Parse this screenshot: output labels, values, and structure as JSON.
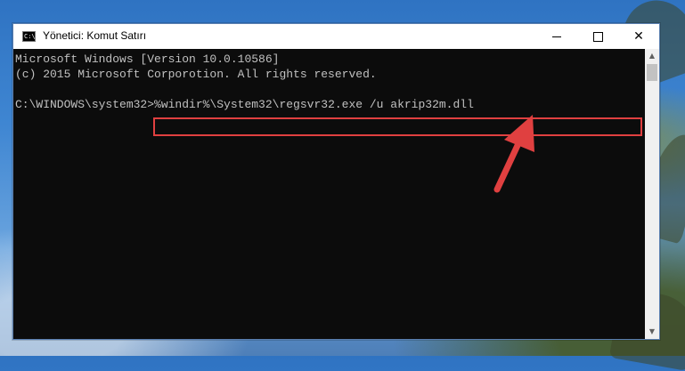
{
  "window": {
    "title": "Yönetici: Komut Satırı",
    "icon_label": "C:\\",
    "buttons": {
      "minimize": "minimize-icon",
      "maximize": "maximize-icon",
      "close": "✕"
    }
  },
  "console": {
    "lines": [
      "Microsoft Windows [Version 10.0.10586]",
      "(c) 2015 Microsoft Corporotion. All rights reserved."
    ],
    "prompt": "C:\\WINDOWS\\system32>",
    "command": "%windir%\\System32\\regsvr32.exe /u akrip32m.dll"
  },
  "scrollbar": {
    "up": "▲",
    "down": "▼"
  },
  "annotation": {
    "highlight_color": "#e04040",
    "arrow_color": "#e04040"
  }
}
